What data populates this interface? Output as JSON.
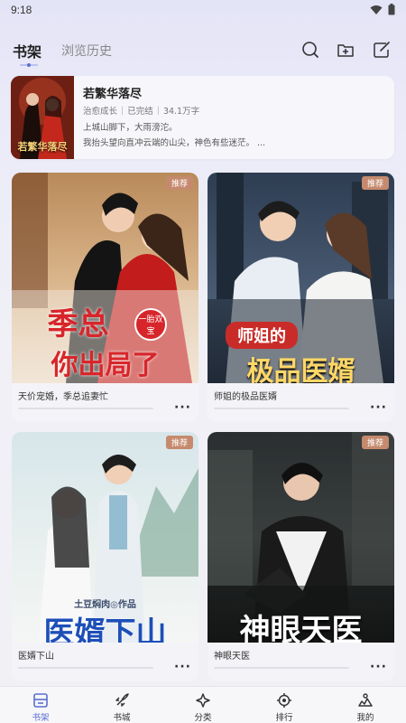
{
  "status_bar": {
    "time": "9:18"
  },
  "header": {
    "tabs": [
      {
        "label": "书架",
        "active": true
      },
      {
        "label": "浏览历史",
        "active": false
      }
    ],
    "icons": [
      "search-icon",
      "add-folder-icon",
      "edit-icon"
    ]
  },
  "recent": {
    "title": "若繁华落尽",
    "cover_text": "若繁华落尽",
    "tag": "治愈成长",
    "status": "已完结",
    "words": "34.1万字",
    "line1": "上城山脚下，大雨滂沱。",
    "line2": "我抬头望向直冲云端的山尖，神色有些迷茫。 ..."
  },
  "books": [
    {
      "name": "天价宠婚，季总追妻忙",
      "badge": "推荐",
      "cover_title_line1": "季总",
      "cover_title_line2": "你出局了",
      "cover_tag": "一胎双宝",
      "cover_author": ""
    },
    {
      "name": "师姐的极品医婿",
      "badge": "推荐",
      "cover_title_line1": "师姐的",
      "cover_title_line2": "极品医婿",
      "cover_tag": "",
      "cover_author": ""
    },
    {
      "name": "医婿下山",
      "badge": "推荐",
      "cover_title_line1": "医婿下山",
      "cover_title_line2": "",
      "cover_tag": "",
      "cover_author": "土豆焖肉◎作品"
    },
    {
      "name": "神眼天医",
      "badge": "推荐",
      "cover_title_line1": "神眼天医",
      "cover_title_line2": "",
      "cover_tag": "",
      "cover_author": ""
    }
  ],
  "bottom_nav": [
    {
      "label": "书架",
      "icon": "bookshelf-icon",
      "active": true
    },
    {
      "label": "书城",
      "icon": "rocket-icon",
      "active": false
    },
    {
      "label": "分类",
      "icon": "category-icon",
      "active": false
    },
    {
      "label": "排行",
      "icon": "ranking-icon",
      "active": false
    },
    {
      "label": "我的",
      "icon": "profile-icon",
      "active": false
    }
  ],
  "colors": {
    "accent": "#5b6fd0",
    "badge": "#c58a6e"
  }
}
